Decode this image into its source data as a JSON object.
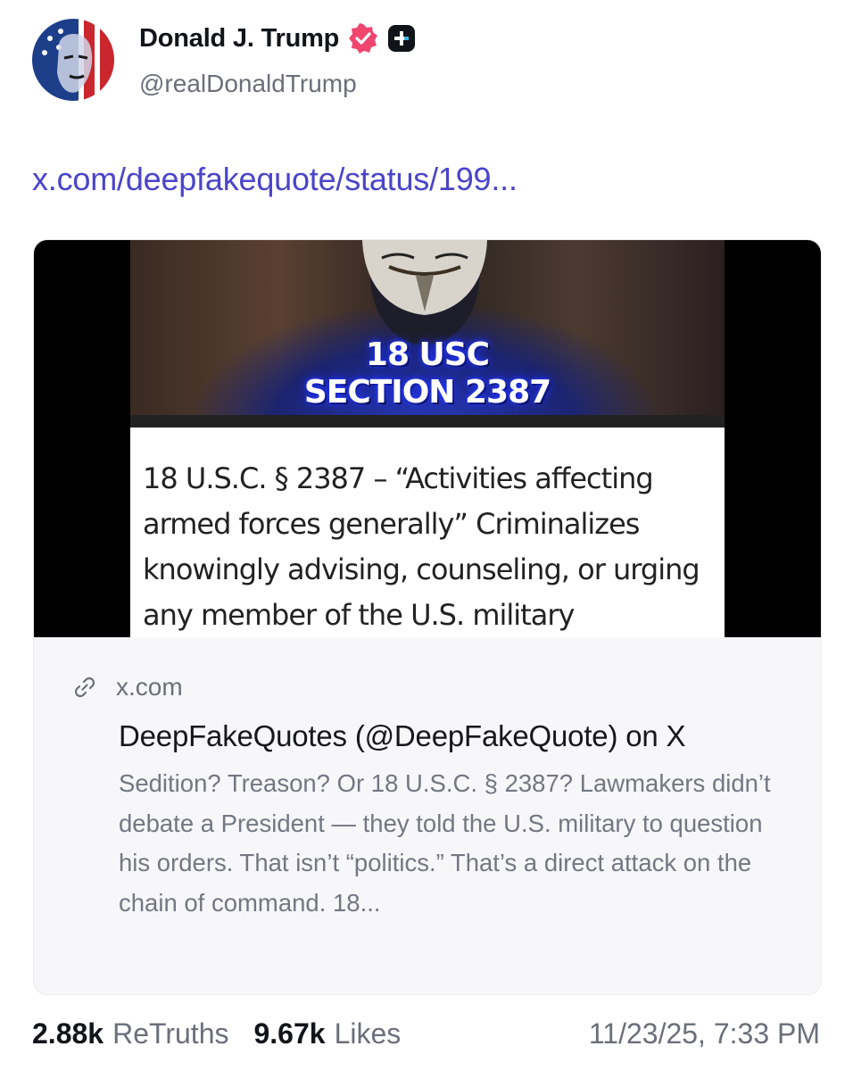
{
  "author": {
    "display_name": "Donald J. Trump",
    "handle": "@realDonaldTrump",
    "verified_icon": "verified-badge-icon",
    "plus_icon": "truth-plus-icon"
  },
  "post": {
    "link_text": "x.com/deepfakequote/status/199..."
  },
  "link_card": {
    "image_caption_line1": "18 USC",
    "image_caption_line2": "SECTION 2387",
    "image_body_text": "18 U.S.C. § 2387 – “Activities affecting armed forces generally” Criminalizes knowingly advising, counseling, or urging any member of the U.S. military",
    "domain": "x.com",
    "title": "DeepFakeQuotes (@DeepFakeQuote) on X",
    "description": "Sedition? Treason? Or 18 U.S.C. § 2387? Lawmakers didn’t debate a President — they told the U.S. military to question his orders. That isn’t “politics.” That’s a direct attack on the chain of command. 18..."
  },
  "stats": {
    "retruths_count": "2.88k",
    "retruths_label": "ReTruths",
    "likes_count": "9.67k",
    "likes_label": "Likes",
    "timestamp": "11/23/25, 7:33 PM"
  },
  "colors": {
    "link": "#4a45c9",
    "verified": "#f0466e",
    "muted": "#6b6f7a"
  }
}
